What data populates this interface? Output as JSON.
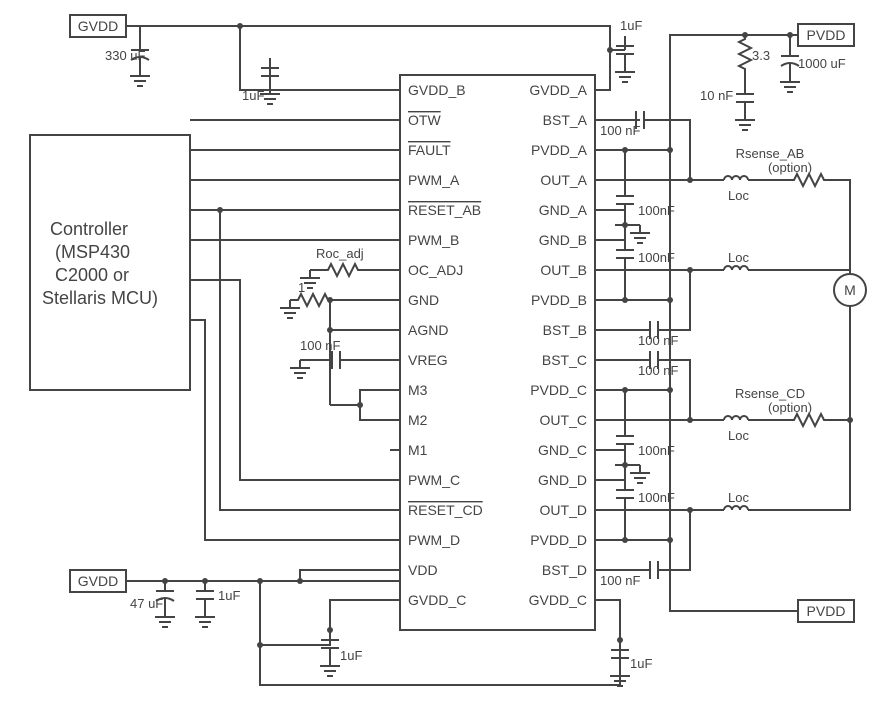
{
  "terminals": {
    "gvdd_top": "GVDD",
    "gvdd_bottom": "GVDD",
    "pvdd_top": "PVDD",
    "pvdd_bottom": "PVDD"
  },
  "controller": {
    "line1": "Controller",
    "line2": "(MSP430",
    "line3": "C2000 or",
    "line4": "Stellaris MCU)"
  },
  "ic": {
    "left_pins": [
      "GVDD_B",
      "OTW",
      "FAULT",
      "PWM_A",
      "RESET_AB",
      "PWM_B",
      "OC_ADJ",
      "GND",
      "AGND",
      "VREG",
      "M3",
      "M2",
      "M1",
      "PWM_C",
      "RESET_CD",
      "PWM_D",
      "VDD",
      "GVDD_C"
    ],
    "right_pins": [
      "GVDD_A",
      "BST_A",
      "PVDD_A",
      "OUT_A",
      "GND_A",
      "GND_B",
      "OUT_B",
      "PVDD_B",
      "BST_B",
      "BST_C",
      "PVDD_C",
      "OUT_C",
      "GND_C",
      "GND_D",
      "OUT_D",
      "PVDD_D",
      "BST_D",
      "GVDD_C"
    ],
    "overline_left": {
      "OTW": true,
      "FAULT": true,
      "RESET_AB": true,
      "RESET_CD": true
    }
  },
  "components": {
    "c_330uF": "330 uF",
    "c_47uF": "47 uF",
    "c_1uF": "1uF",
    "c_100nF": "100 nF",
    "c_100nF_tight": "100nF",
    "c_10nF": "10 nF",
    "c_1000uF": "1000 uF",
    "r_3_3": "3.3",
    "r_1": "1",
    "roc_adj": "Roc_adj",
    "rsense_ab": "Rsense_AB",
    "rsense_cd": "Rsense_CD",
    "option": "(option)",
    "loc": "Loc",
    "motor": "M"
  }
}
